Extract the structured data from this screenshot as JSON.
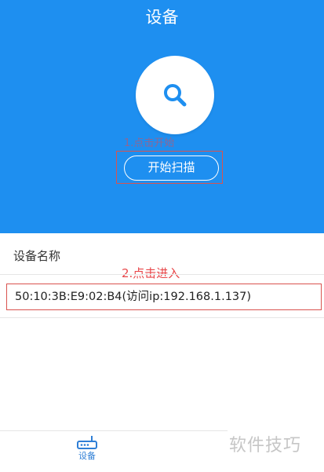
{
  "header": {
    "title": "设备",
    "scan_button_label": "开始扫描",
    "annotation_step1": "1.点击开始",
    "scan_icon": "search-icon",
    "background_color": "#1e8ff0"
  },
  "device_list": {
    "section_label": "设备名称",
    "annotation_step2": "2.点击进入",
    "items": [
      {
        "label": "50:10:3B:E9:02:B4(访问ip:192.168.1.137)"
      }
    ]
  },
  "bottom_nav": {
    "tabs": [
      {
        "label": "设备",
        "icon": "router-icon",
        "active": true
      }
    ]
  },
  "watermark": "软件技巧",
  "colors": {
    "accent": "#1e8ff0",
    "annotation_red": "#e8474a",
    "tab_active": "#2f7fd6"
  }
}
